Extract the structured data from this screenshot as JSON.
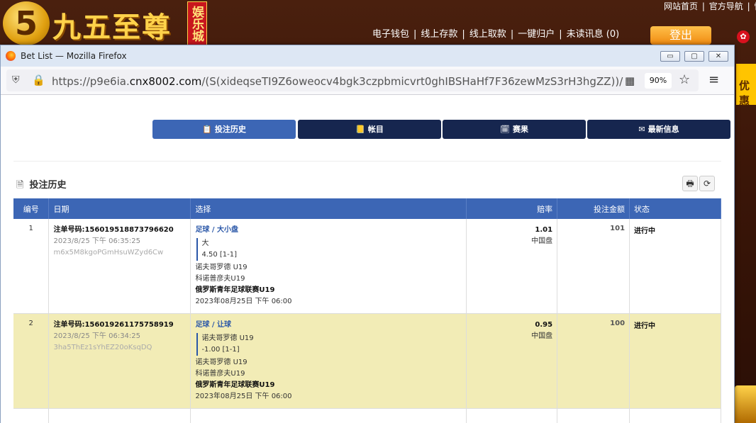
{
  "site": {
    "brand": "九五至尊",
    "brand_tag": "娱乐城",
    "logo_glyph": "5",
    "top_links": [
      "网站首页",
      "|",
      "官方导航",
      "|",
      "快"
    ],
    "nav": [
      "电子钱包",
      "线上存款",
      "线上取款",
      "一键归户",
      "未读讯息 (0)"
    ],
    "logout": "登出",
    "promo": "优惠"
  },
  "window": {
    "title": "Bet List — Mozilla Firefox",
    "minimize": "▭",
    "maximize": "▢",
    "close": "✕"
  },
  "urlbar": {
    "prefix": "https://p9e6ia.",
    "domain": "cnx8002.com",
    "path": "/(S(xideqseTI9Z6oweocv4bgk3czpbmicvrt0ghIBSHaHf7F36zewMzS3rH3hgZZ))/Statement/BetL",
    "zoom": "90%"
  },
  "tabs": [
    {
      "label": "投注历史",
      "icon": "📋"
    },
    {
      "label": "帐目",
      "icon": "📒"
    },
    {
      "label": "赛果",
      "icon": "🗓"
    },
    {
      "label": "最新信息",
      "icon": "✉"
    }
  ],
  "section": {
    "title": "投注历史",
    "print_icon": "🖶",
    "refresh_icon": "⟳"
  },
  "table": {
    "headers": [
      "编号",
      "日期",
      "选择",
      "赔率",
      "投注金额",
      "状态"
    ],
    "rows": [
      {
        "no": "1",
        "order": "注单号码:156019518873796620",
        "time": "2023/8/25 下午 06:35:25",
        "code": "m6x5M8kgoPGmHsuWZyd6Cw",
        "market": "足球 / 大小盘",
        "pick": "大",
        "line": "4.50 [1-1]",
        "home": "诺夫哥罗德 U19",
        "away": "科诺普彦夫U19",
        "league": "俄罗斯青年足球联赛U19",
        "kickoff": "2023年08月25日 下午 06:00",
        "odds": "1.01",
        "odds_type": "中国盘",
        "amount": "101",
        "status": "进行中"
      },
      {
        "no": "2",
        "order": "注单号码:156019261175758919",
        "time": "2023/8/25 下午 06:34:25",
        "code": "3ha5ThEz1sYhEZ20oKsqDQ",
        "market": "足球 / 让球",
        "pick": "诺夫哥罗德 U19",
        "line": "-1.00 [1-1]",
        "home": "诺夫哥罗德 U19",
        "away": "科诺普彦夫U19",
        "league": "俄罗斯青年足球联赛U19",
        "kickoff": "2023年08月25日 下午 06:00",
        "odds": "0.95",
        "odds_type": "中国盘",
        "amount": "100",
        "status": "进行中"
      }
    ]
  }
}
